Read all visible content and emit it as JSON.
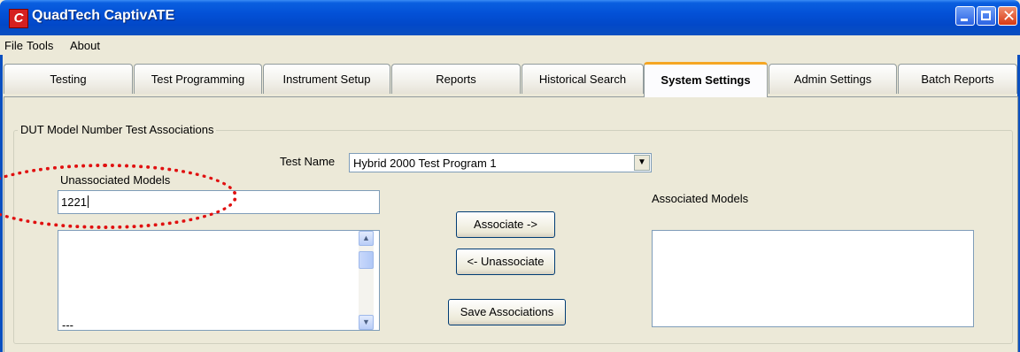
{
  "window": {
    "title": "QuadTech CaptivATE",
    "icon_letter": "C"
  },
  "menu": [
    "File",
    "Tools",
    "About"
  ],
  "tabs": [
    {
      "label": "Testing"
    },
    {
      "label": "Test Programming"
    },
    {
      "label": "Instrument Setup"
    },
    {
      "label": "Reports"
    },
    {
      "label": "Historical Search"
    },
    {
      "label": "System Settings",
      "active": true
    },
    {
      "label": "Admin Settings"
    },
    {
      "label": "Batch Reports"
    }
  ],
  "group": {
    "title": "DUT Model Number Test Associations",
    "test_name_label": "Test Name",
    "test_name_value": "Hybrid 2000 Test Program 1",
    "unassociated_label": "Unassociated Models",
    "unassociated_input": "1221",
    "unassociated_list_partial": "---",
    "associated_label": "Associated Models",
    "buttons": {
      "associate": "Associate ->",
      "unassociate": "<- Unassociate",
      "save": "Save Associations"
    }
  },
  "colors": {
    "highlight": "#e01010",
    "active_tab_accent": "#f5a623",
    "titlebar": "#0350d6"
  }
}
